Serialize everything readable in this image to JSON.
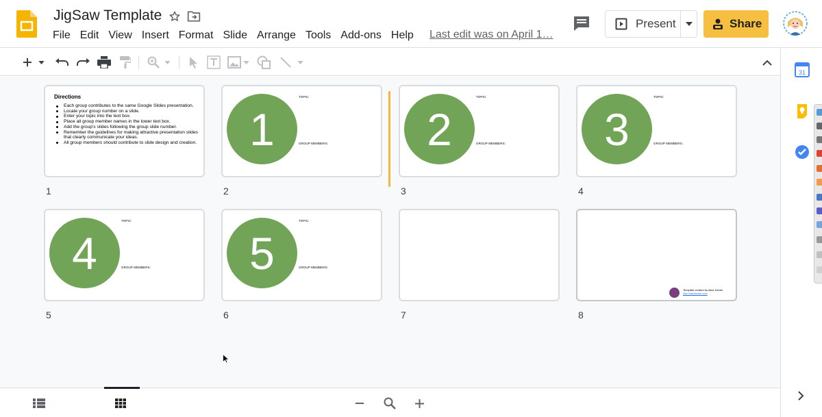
{
  "document": {
    "title": "JigSaw Template",
    "last_edit": "Last edit was on April 1…"
  },
  "menu": {
    "items": [
      "File",
      "Edit",
      "View",
      "Insert",
      "Format",
      "Slide",
      "Arrange",
      "Tools",
      "Add-ons",
      "Help"
    ]
  },
  "header": {
    "present_label": "Present",
    "share_label": "Share"
  },
  "colors": {
    "slides_logo": "#f4b400",
    "share_button": "#f7bf3f",
    "slide_circle": "#71a456",
    "insertion_marker": "#f4b63e"
  },
  "icons": {
    "toolbar": [
      "plus-icon",
      "chevron-down-icon",
      "undo-icon",
      "redo-icon",
      "print-icon",
      "paint-format-icon",
      "zoom-icon",
      "select-icon",
      "text-box-icon",
      "image-icon",
      "shape-icon",
      "line-icon"
    ],
    "side_panel": [
      "calendar-icon",
      "keep-icon",
      "tasks-icon"
    ],
    "bottom": [
      "filmstrip-view-icon",
      "grid-view-icon",
      "zoom-out-icon",
      "zoom-reset-icon",
      "zoom-in-icon"
    ]
  },
  "side_panel": {
    "calendar_day": "31"
  },
  "slides": [
    {
      "number": "1",
      "title": "Directions",
      "bullets": [
        "Each group contributes to the same Google Slides presentation.",
        "Locate your group number on a slide.",
        "Enter your topic into the text box.",
        "Place all group member names in the lower text box.",
        "Add the group's slides following the group slide number.",
        "Remember the guidelines for making attractive presentation slides that clearly communicate your ideas.",
        "All group members should contribute to slide design and creation."
      ]
    },
    {
      "number": "2",
      "circle": "1",
      "topic": "TOPIC:",
      "members": "GROUP MEMBERS:"
    },
    {
      "number": "3",
      "circle": "2",
      "topic": "TOPIC:",
      "members": "GROUP MEMBERS:"
    },
    {
      "number": "4",
      "circle": "3",
      "topic": "TOPIC:",
      "members": "GROUP MEMBERS:"
    },
    {
      "number": "5",
      "circle": "4",
      "topic": "TOPIC:",
      "members": "GROUP MEMBERS:"
    },
    {
      "number": "6",
      "circle": "5",
      "topic": "TOPIC:",
      "members": "GROUP MEMBERS:"
    },
    {
      "number": "7"
    },
    {
      "number": "8",
      "credit": "Template created by Alice Keeler",
      "credit_link": "http://alicekeeler.com"
    }
  ]
}
